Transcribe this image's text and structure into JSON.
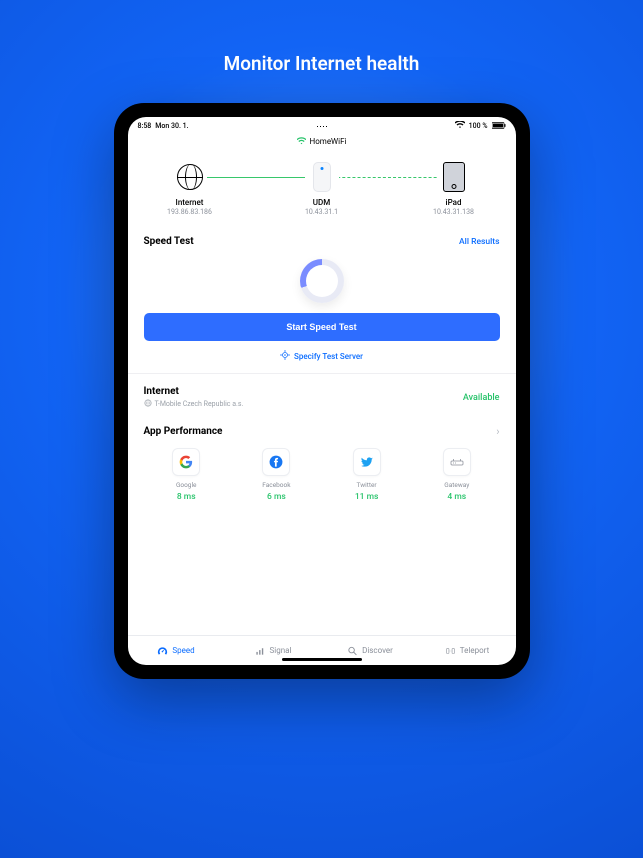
{
  "hero": {
    "title": "Monitor Internet health"
  },
  "status": {
    "time": "8:58",
    "date": "Mon 30. 1.",
    "battery": "100 %"
  },
  "wifi_name": "HomeWiFi",
  "topology": {
    "internet": {
      "label": "Internet",
      "ip": "193.86.83.186"
    },
    "udm": {
      "label": "UDM",
      "ip": "10.43.31.1"
    },
    "ipad": {
      "label": "iPad",
      "ip": "10.43.31.138"
    }
  },
  "speed_test": {
    "title": "Speed Test",
    "all_results": "All Results",
    "start_button": "Start Speed Test",
    "specify": "Specify Test Server"
  },
  "internet": {
    "title": "Internet",
    "isp": "T-Mobile Czech Republic a.s.",
    "status": "Available"
  },
  "app_perf": {
    "title": "App Performance",
    "apps": [
      {
        "name": "Google",
        "ms": "8 ms"
      },
      {
        "name": "Facebook",
        "ms": "6 ms"
      },
      {
        "name": "Twitter",
        "ms": "11 ms"
      },
      {
        "name": "Gateway",
        "ms": "4 ms"
      }
    ]
  },
  "nav": {
    "speed": "Speed",
    "signal": "Signal",
    "discover": "Discover",
    "teleport": "Teleport"
  }
}
